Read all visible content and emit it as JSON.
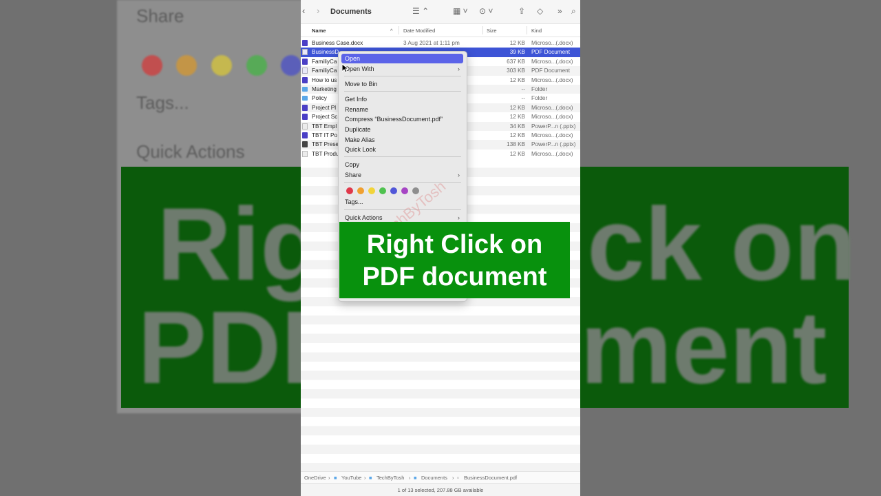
{
  "background": {
    "share_label": "Share",
    "tags_label": "Tags...",
    "quick_actions_label": "Quick Actions",
    "big_left_1": "Rig",
    "big_left_2": "PDF",
    "big_right_1": "ck on",
    "big_right_2": "ment"
  },
  "toolbar": {
    "title": "Documents",
    "back_icon": "chevron-left-icon",
    "forward_icon": "chevron-right-icon"
  },
  "columns": {
    "name": "Name",
    "date": "Date Modified",
    "size": "Size",
    "kind": "Kind"
  },
  "files": [
    {
      "name": "Business Case.docx",
      "date": "3 Aug 2021 at 1:11 pm",
      "size": "12 KB",
      "kind": "Microso...(.docx)",
      "icon": "doc"
    },
    {
      "name": "BusinessD",
      "date": "",
      "size": "39 KB",
      "kind": "PDF Document",
      "icon": "pdf"
    },
    {
      "name": "FamiliyCa",
      "date": "",
      "size": "637 KB",
      "kind": "Microso...(.docx)",
      "icon": "doc"
    },
    {
      "name": "FamiliyCa",
      "date": "",
      "size": "303 KB",
      "kind": "PDF Document",
      "icon": "pdf"
    },
    {
      "name": "How to us",
      "date": "",
      "size": "12 KB",
      "kind": "Microso...(.docx)",
      "icon": "doc"
    },
    {
      "name": "Marketing",
      "date": "",
      "size": "--",
      "kind": "Folder",
      "icon": "folder"
    },
    {
      "name": "Policy",
      "date": "",
      "size": "--",
      "kind": "Folder",
      "icon": "folder"
    },
    {
      "name": "Project Pl",
      "date": "",
      "size": "12 KB",
      "kind": "Microso...(.docx)",
      "icon": "doc"
    },
    {
      "name": "Project Sc",
      "date": "",
      "size": "12 KB",
      "kind": "Microso...(.docx)",
      "icon": "doc"
    },
    {
      "name": "TBT Empl",
      "date": "",
      "size": "34 KB",
      "kind": "PowerP...n (.pptx)",
      "icon": "file"
    },
    {
      "name": "TBT IT Po",
      "date": "",
      "size": "12 KB",
      "kind": "Microso...(.docx)",
      "icon": "doc"
    },
    {
      "name": "TBT Prese",
      "date": "",
      "size": "138 KB",
      "kind": "PowerP...n (.pptx)",
      "icon": "ppt"
    },
    {
      "name": "TBT Produ",
      "date": "",
      "size": "12 KB",
      "kind": "Microso...(.docx)",
      "icon": "file"
    }
  ],
  "context_menu": {
    "open": "Open",
    "open_with": "Open With",
    "move_to_bin": "Move to Bin",
    "get_info": "Get Info",
    "rename": "Rename",
    "compress": "Compress “BusinessDocument.pdf”",
    "duplicate": "Duplicate",
    "make_alias": "Make Alias",
    "quick_look": "Quick Look",
    "copy": "Copy",
    "share": "Share",
    "tags": "Tags...",
    "quick_actions": "Quick Actions",
    "tag_colors": [
      "#e0384a",
      "#f0a030",
      "#f2d43a",
      "#4fc24f",
      "#5157d8",
      "#a645c4",
      "#8e8e8e"
    ]
  },
  "watermark": "@TechByTosh",
  "pathbar": [
    "OneDrive",
    "YouTube",
    "TechByTosh",
    "Documents",
    "BusinessDocument.pdf"
  ],
  "status": "1 of 13 selected, 207.88 GB available",
  "caption": {
    "line1": "Right Click on",
    "line2": "PDF document"
  }
}
